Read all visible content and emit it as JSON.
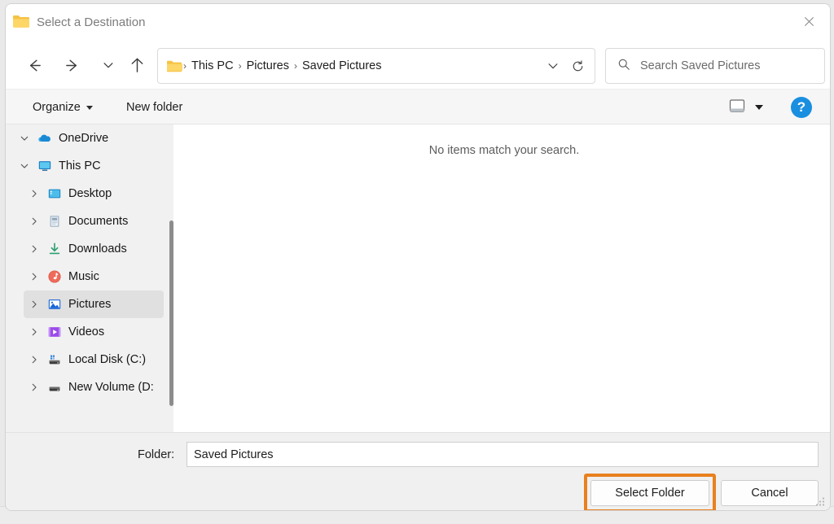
{
  "window": {
    "title": "Select a Destination",
    "title_icon": "folder-icon",
    "close_icon": "close-icon"
  },
  "nav": {
    "back_icon": "arrow-left-icon",
    "forward_icon": "arrow-right-icon",
    "recent_icon": "chevron-down-icon",
    "up_icon": "arrow-up-icon"
  },
  "address": {
    "folder_icon": "folder-icon",
    "separator": "›",
    "crumbs": [
      "This PC",
      "Pictures",
      "Saved Pictures"
    ],
    "dropdown_icon": "chevron-down-icon",
    "refresh_icon": "refresh-icon"
  },
  "search": {
    "icon": "search-icon",
    "placeholder": "Search Saved Pictures",
    "value": ""
  },
  "toolbar": {
    "organize_label": "Organize",
    "new_folder_label": "New folder",
    "view_icon": "preview-pane-icon",
    "view_caret_icon": "caret-down-icon",
    "help_label": "?",
    "help_icon": "help-icon",
    "help_color": "#1a8fe0"
  },
  "sidebar": {
    "items": [
      {
        "label": "OneDrive",
        "icon": "onedrive-cloud-icon",
        "expanded": true,
        "indent": 0,
        "selected": false
      },
      {
        "label": "This PC",
        "icon": "this-pc-monitor-icon",
        "expanded": true,
        "indent": 0,
        "selected": false
      },
      {
        "label": "Desktop",
        "icon": "desktop-icon",
        "expanded": false,
        "indent": 1,
        "selected": false
      },
      {
        "label": "Documents",
        "icon": "documents-icon",
        "expanded": false,
        "indent": 1,
        "selected": false
      },
      {
        "label": "Downloads",
        "icon": "downloads-icon",
        "expanded": false,
        "indent": 1,
        "selected": false
      },
      {
        "label": "Music",
        "icon": "music-icon",
        "expanded": false,
        "indent": 1,
        "selected": false
      },
      {
        "label": "Pictures",
        "icon": "pictures-icon",
        "expanded": false,
        "indent": 1,
        "selected": true
      },
      {
        "label": "Videos",
        "icon": "videos-icon",
        "expanded": false,
        "indent": 1,
        "selected": false
      },
      {
        "label": "Local Disk (C:)",
        "icon": "local-disk-icon",
        "expanded": false,
        "indent": 1,
        "selected": false
      },
      {
        "label": "New Volume (D:",
        "icon": "drive-icon",
        "expanded": false,
        "indent": 1,
        "selected": false
      }
    ]
  },
  "content": {
    "empty_message": "No items match your search."
  },
  "footer": {
    "folder_label": "Folder:",
    "folder_value": "Saved Pictures",
    "select_button": "Select Folder",
    "cancel_button": "Cancel",
    "highlight_color": "#e8811e",
    "resize_grip_icon": "resize-grip-icon"
  }
}
